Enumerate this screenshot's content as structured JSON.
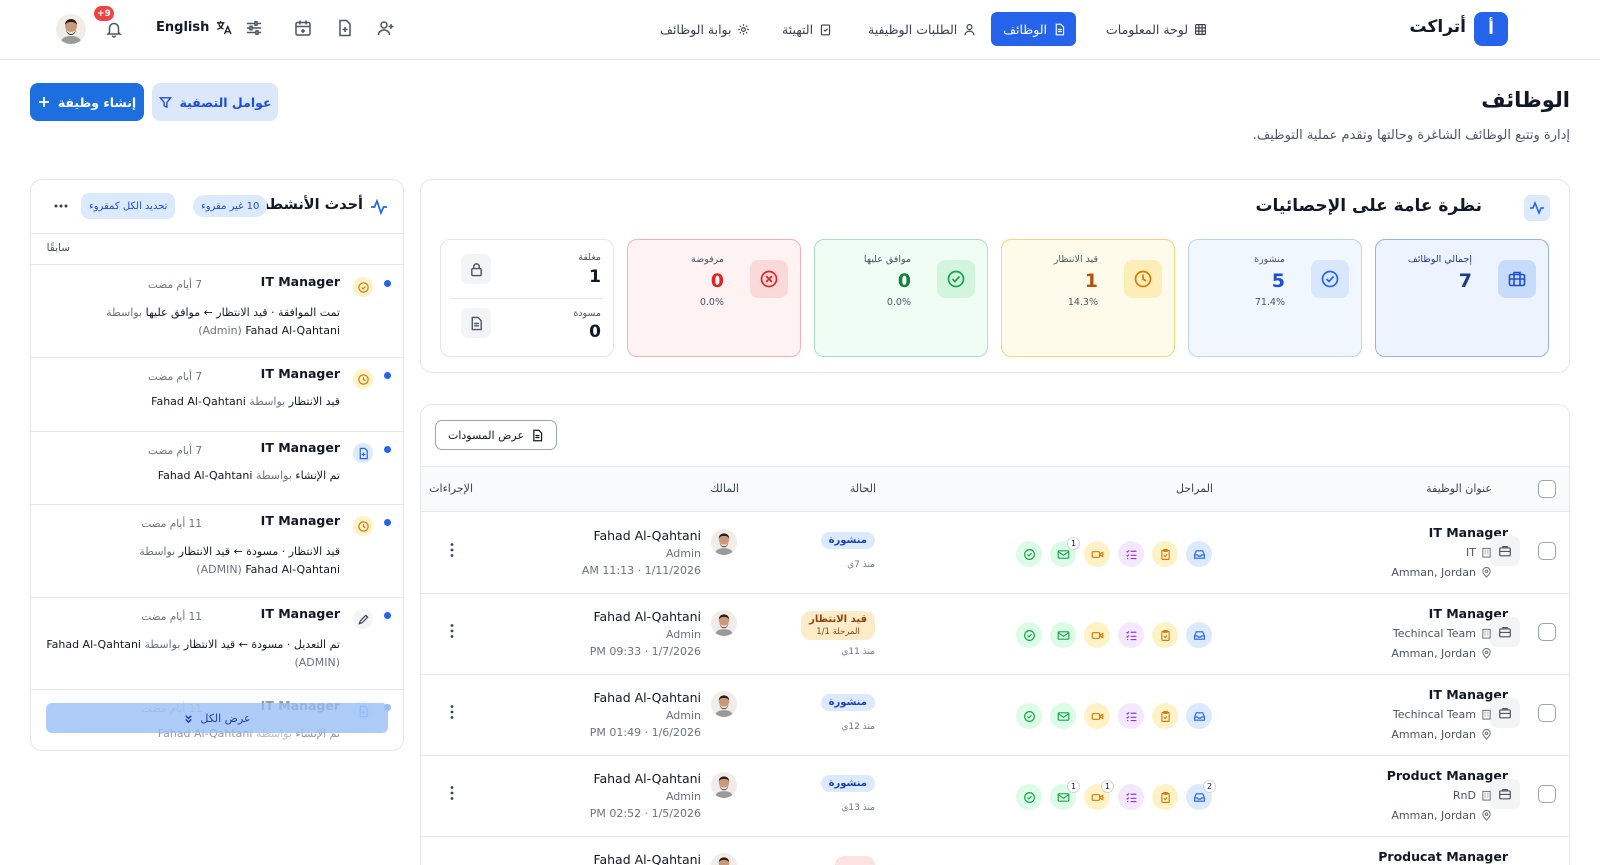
{
  "brand": {
    "name": "أتراكت",
    "logo_letter": "أ"
  },
  "nav": {
    "dashboard": "لوحة المعلومات",
    "jobs": "الوظائف",
    "applications": "الطلبات الوظيفية",
    "onboarding": "التهيئة",
    "portal": "بوابة الوظائف"
  },
  "topbar": {
    "language": "English",
    "notif_count": "+9"
  },
  "page": {
    "title": "الوظائف",
    "subtitle": "إدارة وتتبع الوظائف الشاغرة وحالتها وتقدم عملية التوظيف.",
    "create_label": "إنشاء وظيفة",
    "filters_label": "عوامل التصفية"
  },
  "stats": {
    "title": "نظرة عامة على الإحصائيات",
    "total": {
      "label": "إجمالي الوظائف",
      "value": "7"
    },
    "published": {
      "label": "منشورة",
      "value": "5",
      "pct": "71.4%"
    },
    "pending": {
      "label": "قيد الانتظار",
      "value": "1",
      "pct": "14.3%"
    },
    "approved": {
      "label": "موافق عليها",
      "value": "0",
      "pct": "0.0%"
    },
    "rejected": {
      "label": "مرفوضة",
      "value": "0",
      "pct": "0.0%"
    },
    "closed": {
      "label": "مغلقة",
      "value": "1"
    },
    "draft": {
      "label": "مسودة",
      "value": "0"
    }
  },
  "table": {
    "view_drafts": "عرض المسودات",
    "headers": {
      "title": "عنوان الوظيفة",
      "stages": "المراحل",
      "status": "الحالة",
      "owner": "المالك",
      "actions": "الإجراءات"
    },
    "rows": [
      {
        "title": "IT Manager",
        "dept": "IT",
        "location": "Amman, Jordan",
        "status": "منشورة",
        "status_sub": "منذ 7ي",
        "owner": "Fahad Al-Qahtani",
        "role": "Admin",
        "date": "1/11/2026 · 11:13 AM",
        "badges": {
          "mail": "1"
        }
      },
      {
        "title": "IT Manager",
        "dept": "Techincal Team",
        "location": "Amman, Jordan",
        "status": "قيد الانتظار",
        "status_stage": "المرحلة 1/1",
        "status_sub": "منذ 11ي",
        "owner": "Fahad Al-Qahtani",
        "role": "Admin",
        "date": "1/7/2026 · 09:33 PM",
        "badges": {}
      },
      {
        "title": "IT Manager",
        "dept": "Techincal Team",
        "location": "Amman, Jordan",
        "status": "منشورة",
        "status_sub": "منذ 12ي",
        "owner": "Fahad Al-Qahtani",
        "role": "Admin",
        "date": "1/6/2026 · 01:49 PM",
        "badges": {}
      },
      {
        "title": "Product Manager",
        "dept": "RnD",
        "location": "Amman, Jordan",
        "status": "منشورة",
        "status_sub": "منذ 13ي",
        "owner": "Fahad Al-Qahtani",
        "role": "Admin",
        "date": "1/5/2026 · 02:52 PM",
        "badges": {
          "mail": "1",
          "video": "1",
          "inbox": "2"
        }
      },
      {
        "title": "Producat Manager",
        "owner": "Fahad Al-Qahtani"
      }
    ]
  },
  "activity": {
    "title": "أحدث الأنشطة",
    "unread": "10 غير مقروء",
    "mark_all": "تحديد الكل كمقروء",
    "section": "سابقًا",
    "view_all": "عرض الكل",
    "items": [
      {
        "title": "IT Manager",
        "time": "7 أيام مضت",
        "line1": "تمت الموافقة · قيد الانتظار ← موافق عليها",
        "by": "بواسطة",
        "line2_name": "Fahad Al-Qahtani",
        "line2_role": "(Admin)"
      },
      {
        "title": "IT Manager",
        "time": "7 أيام مضت",
        "action": "قيد الانتظار",
        "by": "بواسطة",
        "name": "Fahad Al-Qahtani"
      },
      {
        "title": "IT Manager",
        "time": "7 أيام مضت",
        "action": "تم الإنشاء",
        "by": "بواسطة",
        "name": "Fahad Al-Qahtani"
      },
      {
        "title": "IT Manager",
        "time": "11 أيام مضت",
        "line1": "قيد الانتظار · مسودة ← قيد الانتظار",
        "by": "بواسطة",
        "line2_name": "Fahad Al-Qahtani",
        "line2_role": "(ADMIN)"
      },
      {
        "title": "IT Manager",
        "time": "11 أيام مضت",
        "line1": "تم التعديل · مسودة ← قيد الانتظار",
        "by": "بواسطة",
        "name": "Fahad Al-Qahtani",
        "line2_role": "(ADMIN)"
      },
      {
        "title": "IT Manager",
        "time": "11 أيام مضت",
        "action": "تم الإنشاء",
        "by": "بواسطة",
        "name": "Fahad Al-Qahtani"
      }
    ]
  },
  "colors": {
    "primary": "#2563eb",
    "published": "#2563eb",
    "pending": "#d97706",
    "approved": "#16a34a",
    "rejected": "#dc2626"
  }
}
